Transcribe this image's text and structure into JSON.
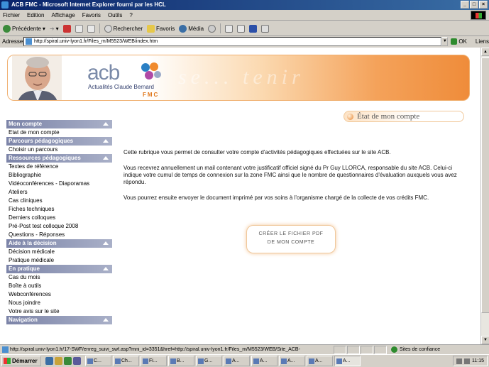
{
  "window": {
    "title": "ACB FMC - Microsoft Internet Explorer fourni par les HCL"
  },
  "menu": [
    "Fichier",
    "Edition",
    "Affichage",
    "Favoris",
    "Outils",
    "?"
  ],
  "toolbar": {
    "back": "Précédente",
    "search": "Rechercher",
    "favorites": "Favoris",
    "media": "Média"
  },
  "address": {
    "label": "Adresse",
    "url": "http://spiral.univ-lyon1.fr/Files_m/M5523/WEB/index.htm",
    "go": "OK",
    "links": "Liens"
  },
  "banner": {
    "logo": "acb",
    "subtitle": "Actualités Claude Bernard",
    "fmc": "FMC",
    "ghost": "se... tenir"
  },
  "page_title": "État de mon compte",
  "sidebar": [
    {
      "heading": "Mon compte",
      "items": [
        "Etat de mon compte"
      ]
    },
    {
      "heading": "Parcours pédagogiques",
      "items": [
        "Choisir un parcours"
      ]
    },
    {
      "heading": "Ressources pédagogiques",
      "items": [
        "Textes de référence",
        "Bibliographie",
        "Vidéoconférences - Diaporamas",
        "Ateliers",
        "Cas cliniques",
        "Fiches techniques",
        "Derniers colloques",
        "Pré-Post test colloque 2008",
        "Questions - Réponses"
      ]
    },
    {
      "heading": "Aide à la décision",
      "items": [
        "Décision médicale",
        "Pratique médicale"
      ]
    },
    {
      "heading": "En pratique",
      "items": [
        "Cas du mois",
        "Boîte à outils",
        "Webconférences",
        "Nous joindre",
        "Votre avis sur le site"
      ]
    },
    {
      "heading": "Navigation",
      "items": []
    }
  ],
  "content": {
    "p1": "Cette rubrique vous permet de consulter votre compte d'activités pédagogiques effectuées sur le site ACB.",
    "p2": "Vous recevrez annuellement un mail contenant votre justificatif officiel signé du Pr Guy LLORCA, responsable du site ACB. Celui-ci indique votre cumul de temps de connexion sur la zone FMC ainsi que le nombre de questionnaires d'évaluation auxquels vous avez répondu.",
    "p3": "Vous pourrez ensuite envoyer le document imprimé par vos soins à l'organisme chargé de la collecte de vos crédits FMC.",
    "cta_line1": "CRÉER LE FICHIER PDF",
    "cta_line2": "DE MON COMPTE"
  },
  "status": {
    "url": "http://spiral.univ-lyon1.fr/17-SWF/enreg_suivi_swf.asp?mni_id=3351&href=http://spiral.univ-lyon1.fr/Files_m/M5523/WEB/Site_ACB-",
    "zone": "Sites de confiance"
  },
  "taskbar": {
    "start": "Démarrer",
    "tasks": [
      "C...",
      "Ch...",
      "Fi...",
      "B...",
      "G...",
      "A...",
      "A...",
      "A...",
      "A...",
      "A..."
    ],
    "clock": "11:15"
  }
}
